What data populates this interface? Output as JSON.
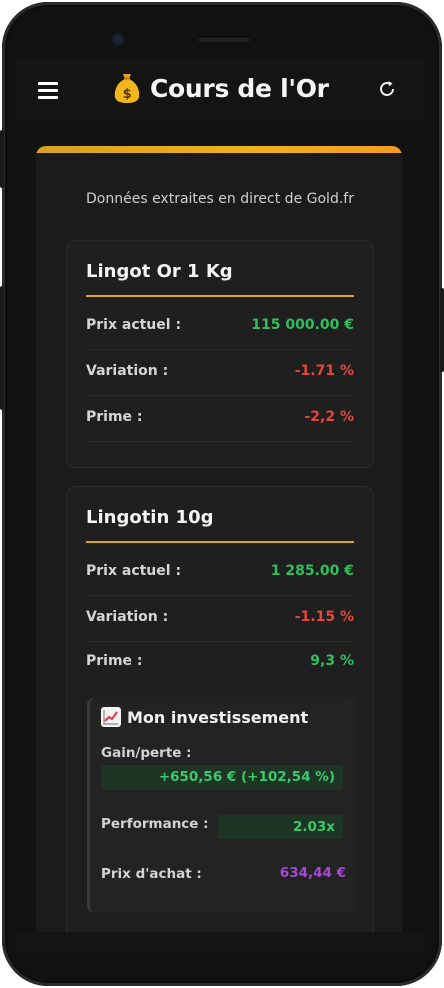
{
  "app": {
    "title": "Cours de l'Or",
    "title_icon": "money-bag-icon",
    "menu_icon": "hamburger-menu-icon",
    "refresh_icon": "refresh-icon"
  },
  "source_text": "Données extraites en direct de Gold.fr",
  "colors": {
    "accent_gold": "#d9a81c",
    "positive": "#2fbf5f",
    "negative": "#e8453c",
    "purchase": "#a54bd3"
  },
  "cards": [
    {
      "title": "Lingot Or 1 Kg",
      "rows": [
        {
          "label": "Prix actuel :",
          "value": "115 000.00 €",
          "tone": "positive"
        },
        {
          "label": "Variation :",
          "value": "-1.71 %",
          "tone": "negative"
        },
        {
          "label": "Prime :",
          "value": "-2,2 %",
          "tone": "negative"
        }
      ]
    },
    {
      "title": "Lingotin 10g",
      "rows": [
        {
          "label": "Prix actuel :",
          "value": "1 285.00 €",
          "tone": "positive"
        },
        {
          "label": "Variation :",
          "value": "-1.15 %",
          "tone": "negative"
        },
        {
          "label": "Prime :",
          "value": "9,3 %",
          "tone": "positive"
        }
      ],
      "investment": {
        "icon": "chart-increasing-icon",
        "title": "Mon investissement",
        "gain_label": "Gain/perte :",
        "gain_value": "+650,56 € (+102,54 %)",
        "performance_label": "Performance :",
        "performance_value": "2.03x",
        "purchase_label": "Prix d'achat :",
        "purchase_value": "634,44 €"
      }
    }
  ]
}
